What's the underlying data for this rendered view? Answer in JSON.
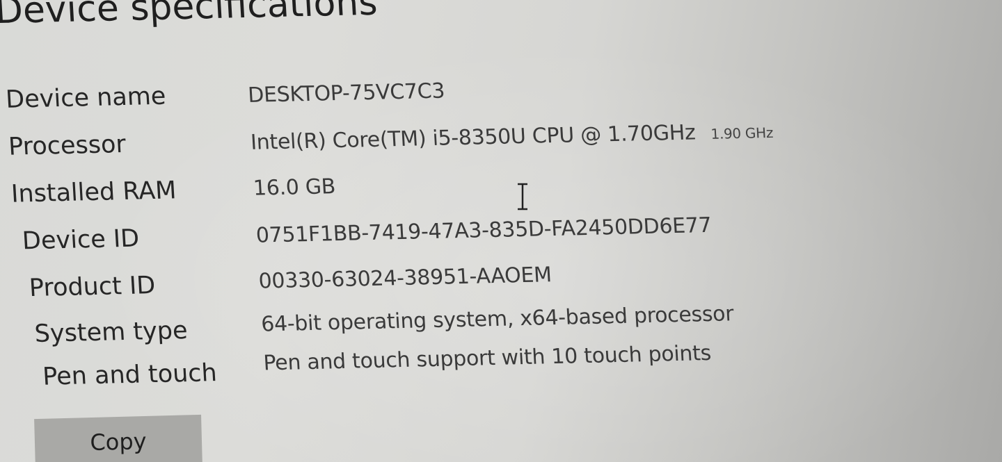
{
  "device_specifications": {
    "title": "Device specifications",
    "specs": [
      {
        "label": "Device name",
        "value": "DESKTOP-75VC7C3"
      },
      {
        "label": "Processor",
        "value": "Intel(R) Core(TM) i5-8350U CPU @ 1.70GHz",
        "value_extra": "1.90 GHz"
      },
      {
        "label": "Installed RAM",
        "value": "16.0 GB"
      },
      {
        "label": "Device ID",
        "value": "0751F1BB-7419-47A3-835D-FA2450DD6E77"
      },
      {
        "label": "Product ID",
        "value": "00330-63024-38951-AAOEM"
      },
      {
        "label": "System type",
        "value": "64-bit operating system, x64-based processor"
      },
      {
        "label": "Pen and touch",
        "value": "Pen and touch support with 10 touch points"
      }
    ],
    "copy_label": "Copy"
  },
  "cursor": {
    "icon": "text-cursor-icon"
  }
}
